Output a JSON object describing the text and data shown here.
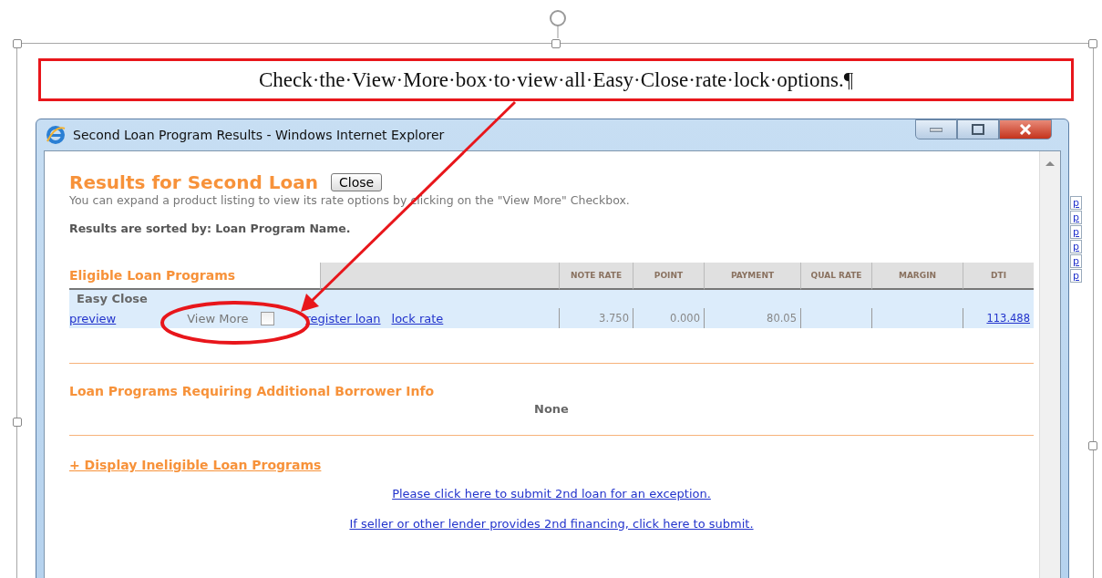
{
  "document": {
    "caption": "Check·the·View·More·box·to·view·all·Easy·Close·rate·lock·options.¶",
    "side_links": [
      "p",
      "p",
      "p",
      "p",
      "p",
      "p"
    ]
  },
  "window": {
    "title": "Second Loan Program Results - Windows Internet Explorer"
  },
  "results": {
    "heading": "Results for Second Loan",
    "close_button": "Close",
    "hint": "You can expand a product listing to view its rate options by clicking on the \"View More\" Checkbox.",
    "sort_note": "Results are sorted by: Loan Program Name."
  },
  "table": {
    "section": "Eligible Loan Programs",
    "columns": [
      "NOTE RATE",
      "POINT",
      "PAYMENT",
      "QUAL RATE",
      "MARGIN",
      "DTI"
    ],
    "rows": [
      {
        "name": "Easy Close",
        "preview": "preview",
        "view_more": "View More",
        "view_more_checked": false,
        "links": [
          "register loan",
          "lock rate"
        ],
        "values": [
          "3.750",
          "0.000",
          "80.05"
        ],
        "dti": "113.488"
      }
    ]
  },
  "additional": {
    "title": "Loan Programs Requiring Additional Borrower Info",
    "content": "None"
  },
  "ineligible_link": "+ Display Ineligible Loan Programs",
  "links": [
    "Please click here to submit 2nd loan for an exception.",
    "If seller or other lender provides 2nd financing, click here to submit."
  ]
}
